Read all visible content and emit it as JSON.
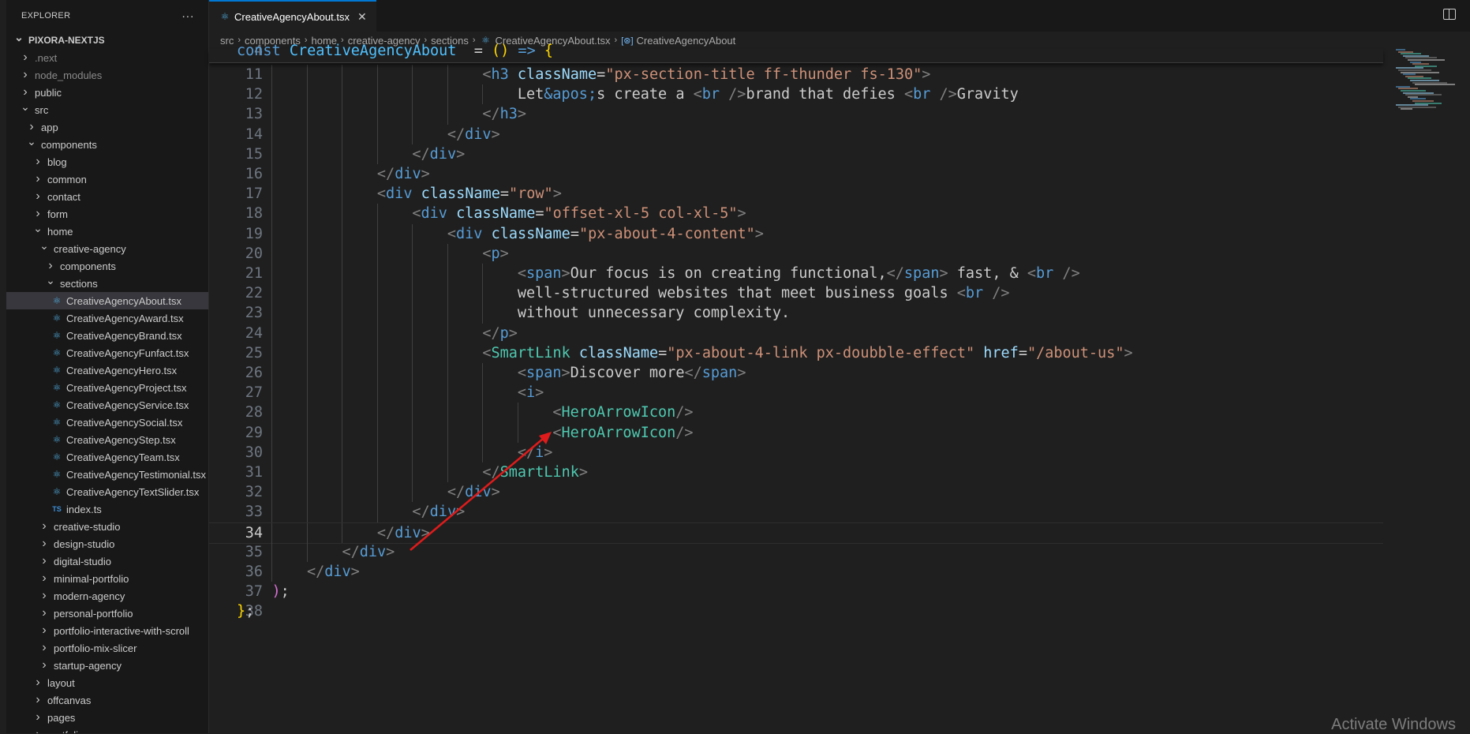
{
  "explorer": {
    "title": "EXPLORER",
    "more_icon": "ellipsis-icon",
    "rows": [
      {
        "label": "PIXORA-NEXTJS",
        "depth": 0,
        "twisty": "down",
        "type": "root"
      },
      {
        "label": ".next",
        "depth": 1,
        "twisty": "right",
        "type": "folder",
        "dim": true
      },
      {
        "label": "node_modules",
        "depth": 1,
        "twisty": "right",
        "type": "folder",
        "dim": true
      },
      {
        "label": "public",
        "depth": 1,
        "twisty": "right",
        "type": "folder"
      },
      {
        "label": "src",
        "depth": 1,
        "twisty": "down",
        "type": "folder"
      },
      {
        "label": "app",
        "depth": 2,
        "twisty": "right",
        "type": "folder"
      },
      {
        "label": "components",
        "depth": 2,
        "twisty": "down",
        "type": "folder"
      },
      {
        "label": "blog",
        "depth": 3,
        "twisty": "right",
        "type": "folder"
      },
      {
        "label": "common",
        "depth": 3,
        "twisty": "right",
        "type": "folder"
      },
      {
        "label": "contact",
        "depth": 3,
        "twisty": "right",
        "type": "folder"
      },
      {
        "label": "form",
        "depth": 3,
        "twisty": "right",
        "type": "folder"
      },
      {
        "label": "home",
        "depth": 3,
        "twisty": "down",
        "type": "folder"
      },
      {
        "label": "creative-agency",
        "depth": 4,
        "twisty": "down",
        "type": "folder"
      },
      {
        "label": "components",
        "depth": 5,
        "twisty": "right",
        "type": "folder"
      },
      {
        "label": "sections",
        "depth": 5,
        "twisty": "down",
        "type": "folder"
      },
      {
        "label": "CreativeAgencyAbout.tsx",
        "depth": 6,
        "type": "react",
        "selected": true
      },
      {
        "label": "CreativeAgencyAward.tsx",
        "depth": 6,
        "type": "react"
      },
      {
        "label": "CreativeAgencyBrand.tsx",
        "depth": 6,
        "type": "react"
      },
      {
        "label": "CreativeAgencyFunfact.tsx",
        "depth": 6,
        "type": "react"
      },
      {
        "label": "CreativeAgencyHero.tsx",
        "depth": 6,
        "type": "react"
      },
      {
        "label": "CreativeAgencyProject.tsx",
        "depth": 6,
        "type": "react"
      },
      {
        "label": "CreativeAgencyService.tsx",
        "depth": 6,
        "type": "react"
      },
      {
        "label": "CreativeAgencySocial.tsx",
        "depth": 6,
        "type": "react"
      },
      {
        "label": "CreativeAgencyStep.tsx",
        "depth": 6,
        "type": "react"
      },
      {
        "label": "CreativeAgencyTeam.tsx",
        "depth": 6,
        "type": "react"
      },
      {
        "label": "CreativeAgencyTestimonial.tsx",
        "depth": 6,
        "type": "react"
      },
      {
        "label": "CreativeAgencyTextSlider.tsx",
        "depth": 6,
        "type": "react"
      },
      {
        "label": "index.ts",
        "depth": 6,
        "type": "ts"
      },
      {
        "label": "creative-studio",
        "depth": 4,
        "twisty": "right",
        "type": "folder"
      },
      {
        "label": "design-studio",
        "depth": 4,
        "twisty": "right",
        "type": "folder"
      },
      {
        "label": "digital-studio",
        "depth": 4,
        "twisty": "right",
        "type": "folder"
      },
      {
        "label": "minimal-portfolio",
        "depth": 4,
        "twisty": "right",
        "type": "folder"
      },
      {
        "label": "modern-agency",
        "depth": 4,
        "twisty": "right",
        "type": "folder"
      },
      {
        "label": "personal-portfolio",
        "depth": 4,
        "twisty": "right",
        "type": "folder"
      },
      {
        "label": "portfolio-interactive-with-scroll",
        "depth": 4,
        "twisty": "right",
        "type": "folder"
      },
      {
        "label": "portfolio-mix-slicer",
        "depth": 4,
        "twisty": "right",
        "type": "folder"
      },
      {
        "label": "startup-agency",
        "depth": 4,
        "twisty": "right",
        "type": "folder"
      },
      {
        "label": "layout",
        "depth": 3,
        "twisty": "right",
        "type": "folder"
      },
      {
        "label": "offcanvas",
        "depth": 3,
        "twisty": "right",
        "type": "folder"
      },
      {
        "label": "pages",
        "depth": 3,
        "twisty": "right",
        "type": "folder"
      },
      {
        "label": "portfolio",
        "depth": 3,
        "twisty": "right",
        "type": "folder"
      }
    ]
  },
  "tab": {
    "label": "CreativeAgencyAbout.tsx",
    "icon": "react-icon",
    "close_icon": "close-icon"
  },
  "toolbar": {
    "split_icon": "split-editor-icon",
    "more_icon": "ellipsis-icon"
  },
  "breadcrumb": [
    "src",
    "components",
    "home",
    "creative-agency",
    "sections",
    "CreativeAgencyAbout.tsx",
    "CreativeAgencyAbout"
  ],
  "sticky_line": {
    "number": "4",
    "tokens": [
      [
        "k",
        "const "
      ],
      [
        "v",
        "CreativeAgencyAbout"
      ],
      [
        "",
        "  = "
      ],
      [
        "p",
        "()"
      ],
      [
        "e",
        " => "
      ],
      [
        "p",
        "{"
      ]
    ]
  },
  "code_lines": [
    {
      "number": "11",
      "indent": 7,
      "tokens": [
        [
          "g",
          "<"
        ],
        [
          "t",
          "h3"
        ],
        [
          "a",
          " className"
        ],
        [
          "",
          "="
        ],
        [
          "s",
          "\"px-section-title ff-thunder fs-130\""
        ],
        [
          "g",
          ">"
        ]
      ]
    },
    {
      "number": "12",
      "indent": 8,
      "tokens": [
        [
          "",
          "Let"
        ],
        [
          "t",
          "&apos;"
        ],
        [
          "",
          "s create a "
        ],
        [
          "g",
          "<"
        ],
        [
          "t",
          "br"
        ],
        [
          "g",
          " />"
        ],
        [
          "",
          "brand that defies "
        ],
        [
          "g",
          "<"
        ],
        [
          "t",
          "br"
        ],
        [
          "g",
          " />"
        ],
        [
          "",
          "Gravity"
        ]
      ]
    },
    {
      "number": "13",
      "indent": 7,
      "tokens": [
        [
          "g",
          "</"
        ],
        [
          "t",
          "h3"
        ],
        [
          "g",
          ">"
        ]
      ]
    },
    {
      "number": "14",
      "indent": 6,
      "tokens": [
        [
          "g",
          "</"
        ],
        [
          "t",
          "div"
        ],
        [
          "g",
          ">"
        ]
      ]
    },
    {
      "number": "15",
      "indent": 5,
      "tokens": [
        [
          "g",
          "</"
        ],
        [
          "t",
          "div"
        ],
        [
          "g",
          ">"
        ]
      ]
    },
    {
      "number": "16",
      "indent": 4,
      "tokens": [
        [
          "g",
          "</"
        ],
        [
          "t",
          "div"
        ],
        [
          "g",
          ">"
        ]
      ]
    },
    {
      "number": "17",
      "indent": 4,
      "tokens": [
        [
          "g",
          "<"
        ],
        [
          "t",
          "div"
        ],
        [
          "a",
          " className"
        ],
        [
          "",
          "="
        ],
        [
          "s",
          "\"row\""
        ],
        [
          "g",
          ">"
        ]
      ]
    },
    {
      "number": "18",
      "indent": 5,
      "tokens": [
        [
          "g",
          "<"
        ],
        [
          "t",
          "div"
        ],
        [
          "a",
          " className"
        ],
        [
          "",
          "="
        ],
        [
          "s",
          "\"offset-xl-5 col-xl-5\""
        ],
        [
          "g",
          ">"
        ]
      ]
    },
    {
      "number": "19",
      "indent": 6,
      "tokens": [
        [
          "g",
          "<"
        ],
        [
          "t",
          "div"
        ],
        [
          "a",
          " className"
        ],
        [
          "",
          "="
        ],
        [
          "s",
          "\"px-about-4-content\""
        ],
        [
          "g",
          ">"
        ]
      ]
    },
    {
      "number": "20",
      "indent": 7,
      "tokens": [
        [
          "g",
          "<"
        ],
        [
          "t",
          "p"
        ],
        [
          "g",
          ">"
        ]
      ]
    },
    {
      "number": "21",
      "indent": 8,
      "tokens": [
        [
          "g",
          "<"
        ],
        [
          "t",
          "span"
        ],
        [
          "g",
          ">"
        ],
        [
          "",
          "Our focus is on creating functional,"
        ],
        [
          "g",
          "</"
        ],
        [
          "t",
          "span"
        ],
        [
          "g",
          ">"
        ],
        [
          "",
          " fast, & "
        ],
        [
          "g",
          "<"
        ],
        [
          "t",
          "br"
        ],
        [
          "g",
          " />"
        ]
      ]
    },
    {
      "number": "22",
      "indent": 8,
      "tokens": [
        [
          "",
          "well-structured websites that meet business goals "
        ],
        [
          "g",
          "<"
        ],
        [
          "t",
          "br"
        ],
        [
          "g",
          " />"
        ]
      ]
    },
    {
      "number": "23",
      "indent": 8,
      "tokens": [
        [
          "",
          "without unnecessary complexity."
        ]
      ]
    },
    {
      "number": "24",
      "indent": 7,
      "tokens": [
        [
          "g",
          "</"
        ],
        [
          "t",
          "p"
        ],
        [
          "g",
          ">"
        ]
      ]
    },
    {
      "number": "25",
      "indent": 7,
      "tokens": [
        [
          "g",
          "<"
        ],
        [
          "c",
          "SmartLink"
        ],
        [
          "a",
          " className"
        ],
        [
          "",
          "="
        ],
        [
          "s",
          "\"px-about-4-link px-doubble-effect\""
        ],
        [
          "a",
          " href"
        ],
        [
          "",
          "="
        ],
        [
          "s",
          "\"/about-us\""
        ],
        [
          "g",
          ">"
        ]
      ]
    },
    {
      "number": "26",
      "indent": 8,
      "tokens": [
        [
          "g",
          "<"
        ],
        [
          "t",
          "span"
        ],
        [
          "g",
          ">"
        ],
        [
          "",
          "Discover more"
        ],
        [
          "g",
          "</"
        ],
        [
          "t",
          "span"
        ],
        [
          "g",
          ">"
        ]
      ]
    },
    {
      "number": "27",
      "indent": 8,
      "tokens": [
        [
          "g",
          "<"
        ],
        [
          "t",
          "i"
        ],
        [
          "g",
          ">"
        ]
      ]
    },
    {
      "number": "28",
      "indent": 9,
      "tokens": [
        [
          "g",
          "<"
        ],
        [
          "c",
          "HeroArrowIcon"
        ],
        [
          "g",
          "/>"
        ]
      ]
    },
    {
      "number": "29",
      "indent": 9,
      "tokens": [
        [
          "g",
          "<"
        ],
        [
          "c",
          "HeroArrowIcon"
        ],
        [
          "g",
          "/>"
        ]
      ]
    },
    {
      "number": "30",
      "indent": 8,
      "tokens": [
        [
          "g",
          "</"
        ],
        [
          "t",
          "i"
        ],
        [
          "g",
          ">"
        ]
      ]
    },
    {
      "number": "31",
      "indent": 7,
      "tokens": [
        [
          "g",
          "</"
        ],
        [
          "c",
          "SmartLink"
        ],
        [
          "g",
          ">"
        ]
      ]
    },
    {
      "number": "32",
      "indent": 6,
      "tokens": [
        [
          "g",
          "</"
        ],
        [
          "t",
          "div"
        ],
        [
          "g",
          ">"
        ]
      ]
    },
    {
      "number": "33",
      "indent": 5,
      "tokens": [
        [
          "g",
          "</"
        ],
        [
          "t",
          "div"
        ],
        [
          "g",
          ">"
        ]
      ]
    },
    {
      "number": "34",
      "indent": 4,
      "tokens": [
        [
          "g",
          "</"
        ],
        [
          "t",
          "div"
        ],
        [
          "g",
          ">"
        ]
      ],
      "active": true
    },
    {
      "number": "35",
      "indent": 3,
      "tokens": [
        [
          "g",
          "</"
        ],
        [
          "t",
          "div"
        ],
        [
          "g",
          ">"
        ]
      ]
    },
    {
      "number": "36",
      "indent": 2,
      "tokens": [
        [
          "g",
          "</"
        ],
        [
          "t",
          "div"
        ],
        [
          "g",
          ">"
        ]
      ]
    },
    {
      "number": "37",
      "indent": 1,
      "tokens": [
        [
          "pm",
          ")"
        ],
        [
          "",
          ";"
        ]
      ]
    },
    {
      "number": "38",
      "indent": 0,
      "tokens": [
        [
          "p",
          "}"
        ],
        [
          "",
          ";"
        ]
      ]
    }
  ],
  "watermark": "Activate Windows",
  "colors": {
    "accent": "#0078d4",
    "annotation_arrow": "#e01b1b",
    "tag": "#569cd6",
    "component": "#4ec9b0",
    "attribute": "#9cdcfe",
    "string": "#ce9178"
  }
}
